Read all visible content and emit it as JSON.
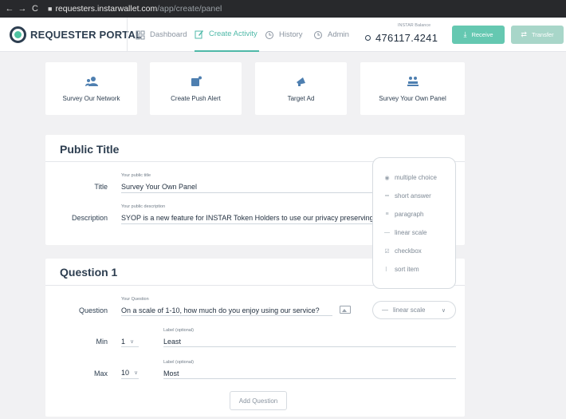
{
  "browser": {
    "back": "←",
    "forward": "→",
    "reload": "C",
    "url_host": "requesters.instarwallet.com",
    "url_path": "/app/create/panel"
  },
  "header": {
    "brand": "REQUESTER PORTAL",
    "nav": [
      {
        "label": "Dashboard",
        "icon": "grid-icon"
      },
      {
        "label": "Create Activity",
        "icon": "edit-icon",
        "active": true
      },
      {
        "label": "History",
        "icon": "history-icon"
      },
      {
        "label": "Admin",
        "icon": "admin-icon"
      }
    ],
    "balance_label": "INSTAR Balance",
    "balance_value": "476117.4241",
    "receive_label": "Receive",
    "transfer_label": "Transfer",
    "accent": "#4fb9a8"
  },
  "activities": [
    {
      "label": "Survey Our Network",
      "icon": "users-icon"
    },
    {
      "label": "Create Push Alert",
      "icon": "alert-icon"
    },
    {
      "label": "Target Ad",
      "icon": "megaphone-icon"
    },
    {
      "label": "Survey Your Own Panel",
      "icon": "panel-icon"
    }
  ],
  "public": {
    "heading": "Public Title",
    "title_label": "Title",
    "title_hint": "Your public title",
    "title_value": "Survey Your Own Panel",
    "desc_label": "Description",
    "desc_hint": "Your public description",
    "desc_value": "SYOP is a new feature for INSTAR Token Holders to use our privacy preserving"
  },
  "question": {
    "heading": "Question 1",
    "question_label": "Question",
    "question_hint": "Your Question",
    "question_value": "On a scale of 1-10, how much do you enjoy using our service?",
    "type_selected": "linear scale",
    "min_label": "Min",
    "min_value": "1",
    "min_label_hint": "Label (optional)",
    "min_label_value": "Least",
    "max_label": "Max",
    "max_value": "10",
    "max_label_hint": "Label (optional)",
    "max_label_value": "Most",
    "add_question": "Add Question"
  },
  "type_options": [
    {
      "label": "multiple choice",
      "icon": "radio-icon"
    },
    {
      "label": "short answer",
      "icon": "short-answer-icon"
    },
    {
      "label": "paragraph",
      "icon": "paragraph-icon"
    },
    {
      "label": "linear scale",
      "icon": "linear-scale-icon"
    },
    {
      "label": "checkbox",
      "icon": "checkbox-icon"
    },
    {
      "label": "sort item",
      "icon": "drag-icon"
    }
  ]
}
